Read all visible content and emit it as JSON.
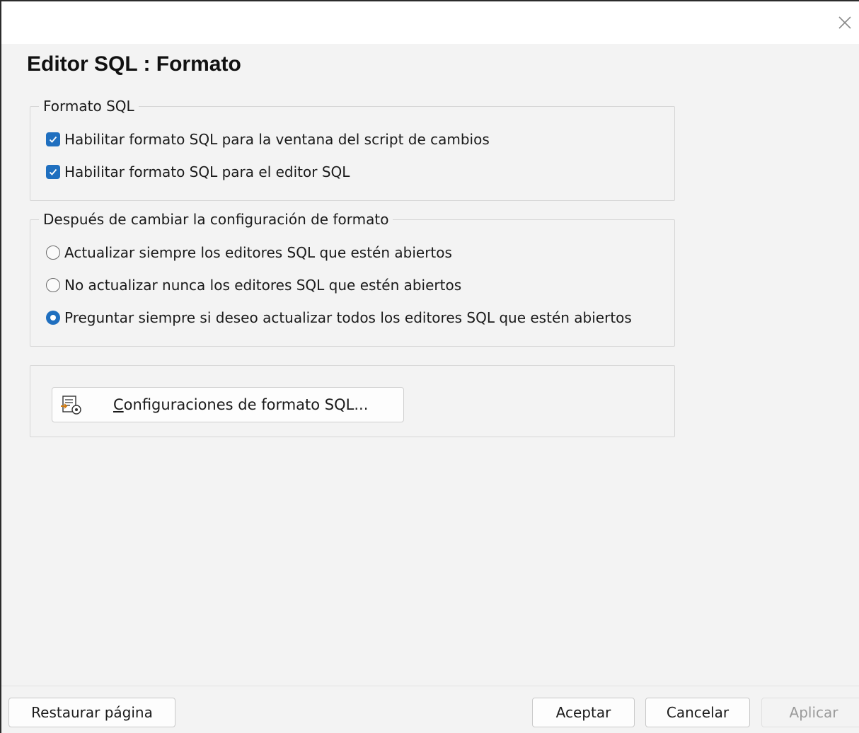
{
  "window": {
    "close_icon": "close-icon"
  },
  "page_title": "Editor SQL : Formato",
  "groups": {
    "sql_format": {
      "legend": "Formato SQL",
      "options": [
        {
          "label": "Habilitar formato SQL para la ventana del script de cambios",
          "checked": true
        },
        {
          "label": "Habilitar formato SQL para el editor SQL",
          "checked": true
        }
      ]
    },
    "after_change": {
      "legend": "Después de cambiar la configuración de formato",
      "options": [
        {
          "label": "Actualizar siempre los editores SQL que estén abiertos",
          "selected": false
        },
        {
          "label": "No actualizar nunca los editores SQL que estén abiertos",
          "selected": false
        },
        {
          "label": "Preguntar siempre si deseo actualizar todos los editores SQL que estén abiertos",
          "selected": true
        }
      ]
    },
    "settings": {
      "button_label_first": "C",
      "button_label_rest": "onfiguraciones de formato SQL...",
      "button_icon": "format-settings-icon"
    }
  },
  "footer": {
    "restore": "Restaurar página",
    "ok": "Aceptar",
    "cancel": "Cancelar",
    "apply": "Aplicar"
  },
  "colors": {
    "accent": "#1f6fbf",
    "panel": "#f3f3f3",
    "disabled_text": "#9a9a9a"
  }
}
